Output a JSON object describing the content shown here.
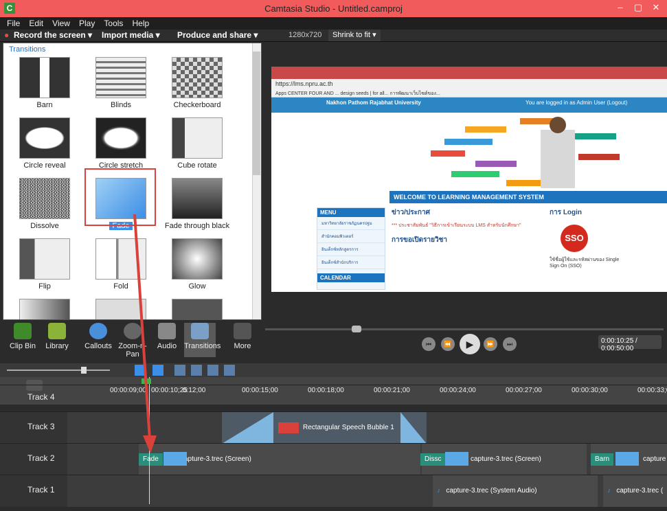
{
  "window": {
    "title": "Camtasia Studio - Untitled.camproj",
    "minimize": "–",
    "maximize": "▢",
    "close": "✕",
    "app_letter": "C"
  },
  "menu": [
    "File",
    "Edit",
    "View",
    "Play",
    "Tools",
    "Help"
  ],
  "toolbar": {
    "record": "Record the screen ▾",
    "import": "Import media ▾",
    "produce": "Produce and share ▾",
    "resolution": "1280x720",
    "zoom": "Shrink to fit ▾"
  },
  "transitions": {
    "title": "Transitions",
    "items": [
      "Barn",
      "Blinds",
      "Checkerboard",
      "Circle reveal",
      "Circle stretch",
      "Cube rotate",
      "Dissolve",
      "Fade",
      "Fade through black",
      "Flip",
      "Fold",
      "Glow"
    ],
    "selected": "Fade"
  },
  "tabs": [
    "Clip Bin",
    "Library",
    "Callouts",
    "Zoom-n-Pan",
    "Audio",
    "Transitions",
    "More"
  ],
  "preview": {
    "url": "https://lms.npru.ac.th",
    "bookmarks": "Apps  CENTER FOUR AND ...  design seeds | for all...  การพัฒนาเว็บไซต์ของ...",
    "university": "Nakhon Pathom Rajabhat University",
    "logged": "You are logged in as Admin User (Logout)",
    "welcome": "WELCOME TO LEARNING MANAGEMENT SYSTEM",
    "menu_title": "MENU",
    "menu_items": [
      "มหาวิทยาลัยราชภัฏนครปฐม",
      "สำนักคอมพิวเตอร์",
      "อินเด็กซ์หลักสูตรการ",
      "อินเด็กซ์สำนักบริการ"
    ],
    "calendar": "CALENDAR",
    "news_title": "ข่าว/ประกาศ",
    "news_text": "*** ประชาสัมพันธ์ \"วิธีการเข้าเรียนระบบ LMS สำหรับนักศึกษา\"",
    "open_title": "การขอเปิดรายวิชา",
    "login_title": "การ Login",
    "sso": "SSO",
    "sso_text": "ใช้ชื่อผู้ใช้และรหัสผ่านของ Single Sign On (SSO)"
  },
  "playback": {
    "timecode": "0:00:10:25 / 0:00:50:00"
  },
  "ruler": [
    "00:00:09;00",
    "00:00:10;25",
    "0:12;00",
    "00:00:15;00",
    "00:00:18;00",
    "00:00:21;00",
    "00:00:24;00",
    "00:00:27;00",
    "00:00:30;00",
    "00:00:33;0"
  ],
  "tracks": [
    {
      "name": "Track 4"
    },
    {
      "name": "Track 3",
      "callout": "Rectangular Speech Bubble 1"
    },
    {
      "name": "Track 2",
      "trans1": "Fade",
      "clip1": "capture-3.trec (Screen)",
      "trans2": "Dissc",
      "clip2": "capture-3.trec (Screen)",
      "trans3": "Barn",
      "clip3": "capture"
    },
    {
      "name": "Track 1",
      "audio1": "capture-3.trec (System Audio)",
      "audio2": "capture-3.trec ("
    }
  ],
  "colors": {
    "titlebar": "#f25b5b",
    "accent": "#3d8ee6",
    "annotation": "#d9413a",
    "transition_clip": "#2a8f7a"
  }
}
